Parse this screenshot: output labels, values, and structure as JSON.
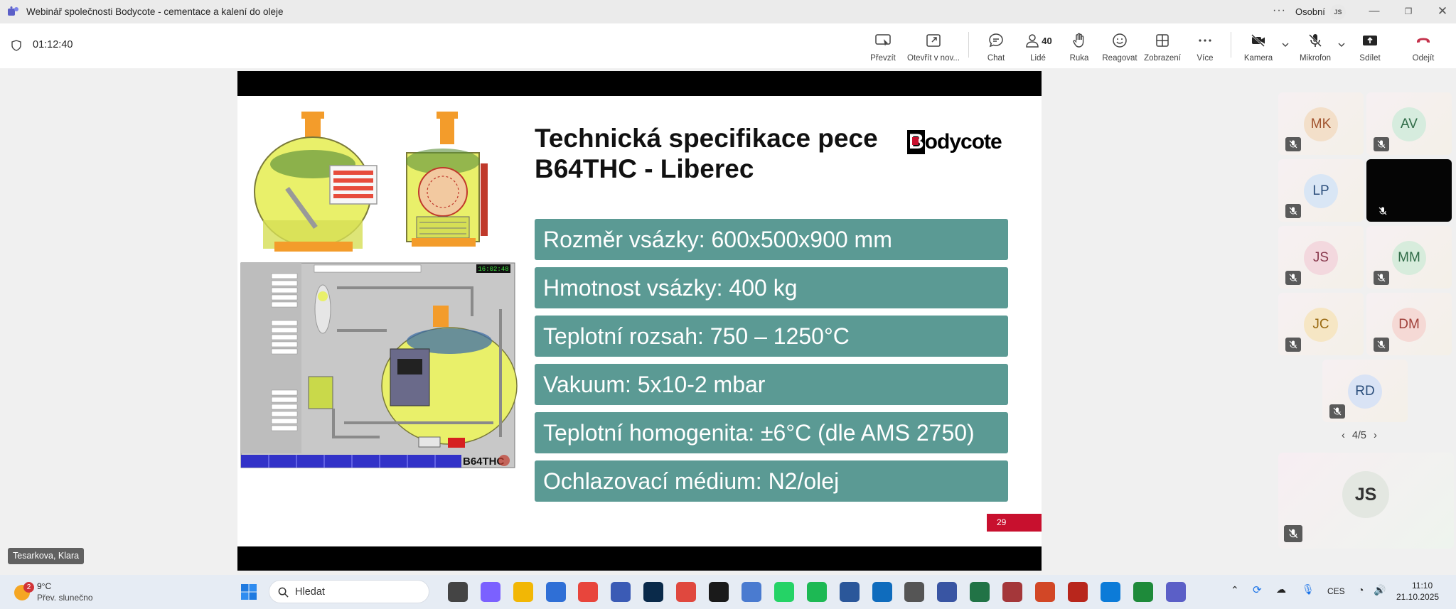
{
  "window": {
    "title": "Webinář společnosti Bodycote - cementace a kalení do oleje",
    "more": "···",
    "profile_label": "Osobní",
    "profile_initials": "JS"
  },
  "meeting": {
    "elapsed": "01:12:40",
    "toolbar": {
      "take_control": "Převzít",
      "open_new": "Otevřít v nov...",
      "chat": "Chat",
      "people": "Lidé",
      "people_count": "40",
      "hand": "Ruka",
      "react": "Reagovat",
      "view": "Zobrazení",
      "more": "Více",
      "camera": "Kamera",
      "mic": "Mikrofon",
      "share": "Sdílet",
      "leave": "Odejít"
    }
  },
  "slide": {
    "title_line1": "Technická specifikace pece",
    "title_line2": "B64THC - Liberec",
    "logo_mark": "B",
    "logo_text": "odycote",
    "specs": [
      "Rozměr vsázky: 600x500x900 mm",
      "Hmotnost vsázky: 400 kg",
      "Teplotní rozsah: 750 – 1250°C",
      "Vakuum: 5x10-2 mbar",
      "Teplotní homogenita: ±6°C (dle AMS 2750)",
      "Ochlazovací médium: N2/olej"
    ],
    "page_number": "29",
    "hmi_clock": "16:02:48",
    "hmi_brand": "B64THC"
  },
  "participants": [
    {
      "initials": "MK",
      "color": "#f3dfc9",
      "text_color": "#a0522d"
    },
    {
      "initials": "AV",
      "color": "#d6ecde",
      "text_color": "#2f6b47"
    },
    {
      "initials": "LP",
      "color": "#d9e6f5",
      "text_color": "#2c4f7c"
    },
    {
      "initials": "",
      "color": "#050505",
      "text_color": "#ffffff"
    },
    {
      "initials": "JS",
      "color": "#f3d8de",
      "text_color": "#8a3b4f"
    },
    {
      "initials": "MM",
      "color": "#d7ecdc",
      "text_color": "#2f6b47"
    },
    {
      "initials": "JC",
      "color": "#f6e6c4",
      "text_color": "#9a6a12"
    },
    {
      "initials": "DM",
      "color": "#f5d9d5",
      "text_color": "#a0403a"
    },
    {
      "initials": "RD",
      "color": "#d9e3f5",
      "text_color": "#2c4f7c"
    }
  ],
  "pager": "4/5",
  "self_initials": "JS",
  "speaker": "Tesarkova, Klara",
  "taskbar": {
    "weather_badge": "2",
    "temp": "9°C",
    "weather_desc": "Přev. slunečno",
    "search_placeholder": "Hledat",
    "lang": "CES",
    "time": "11:10",
    "date": "21.10.2025"
  }
}
